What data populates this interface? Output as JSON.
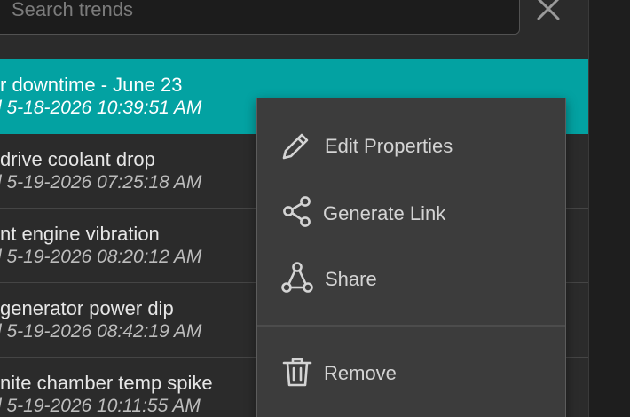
{
  "search": {
    "placeholder": "Search trends",
    "value": ""
  },
  "trends": [
    {
      "title": "r downtime - June 23",
      "date": "l 5-18-2026 10:39:51 AM",
      "selected": true
    },
    {
      "title": "drive coolant drop",
      "date": "l 5-19-2026 07:25:18 AM",
      "selected": false
    },
    {
      "title": "nt engine vibration",
      "date": "l 5-19-2026 08:20:12 AM",
      "selected": false
    },
    {
      "title": "generator power dip",
      "date": "l 5-19-2026 08:42:19 AM",
      "selected": false
    },
    {
      "title": "nite chamber temp spike",
      "date": "l 5-19-2026 10:11:55 AM",
      "selected": false
    }
  ],
  "context_menu": {
    "items": [
      {
        "label": "Edit Properties",
        "icon": "pencil-icon"
      },
      {
        "label": "Generate Link",
        "icon": "share-nodes-icon"
      },
      {
        "label": "Share",
        "icon": "share-triangle-icon"
      },
      {
        "label": "Remove",
        "icon": "trash-icon"
      }
    ]
  },
  "colors": {
    "selected_row": "#03a2a2",
    "panel_background": "#2b2b2b",
    "menu_background": "#3c3c3c"
  }
}
